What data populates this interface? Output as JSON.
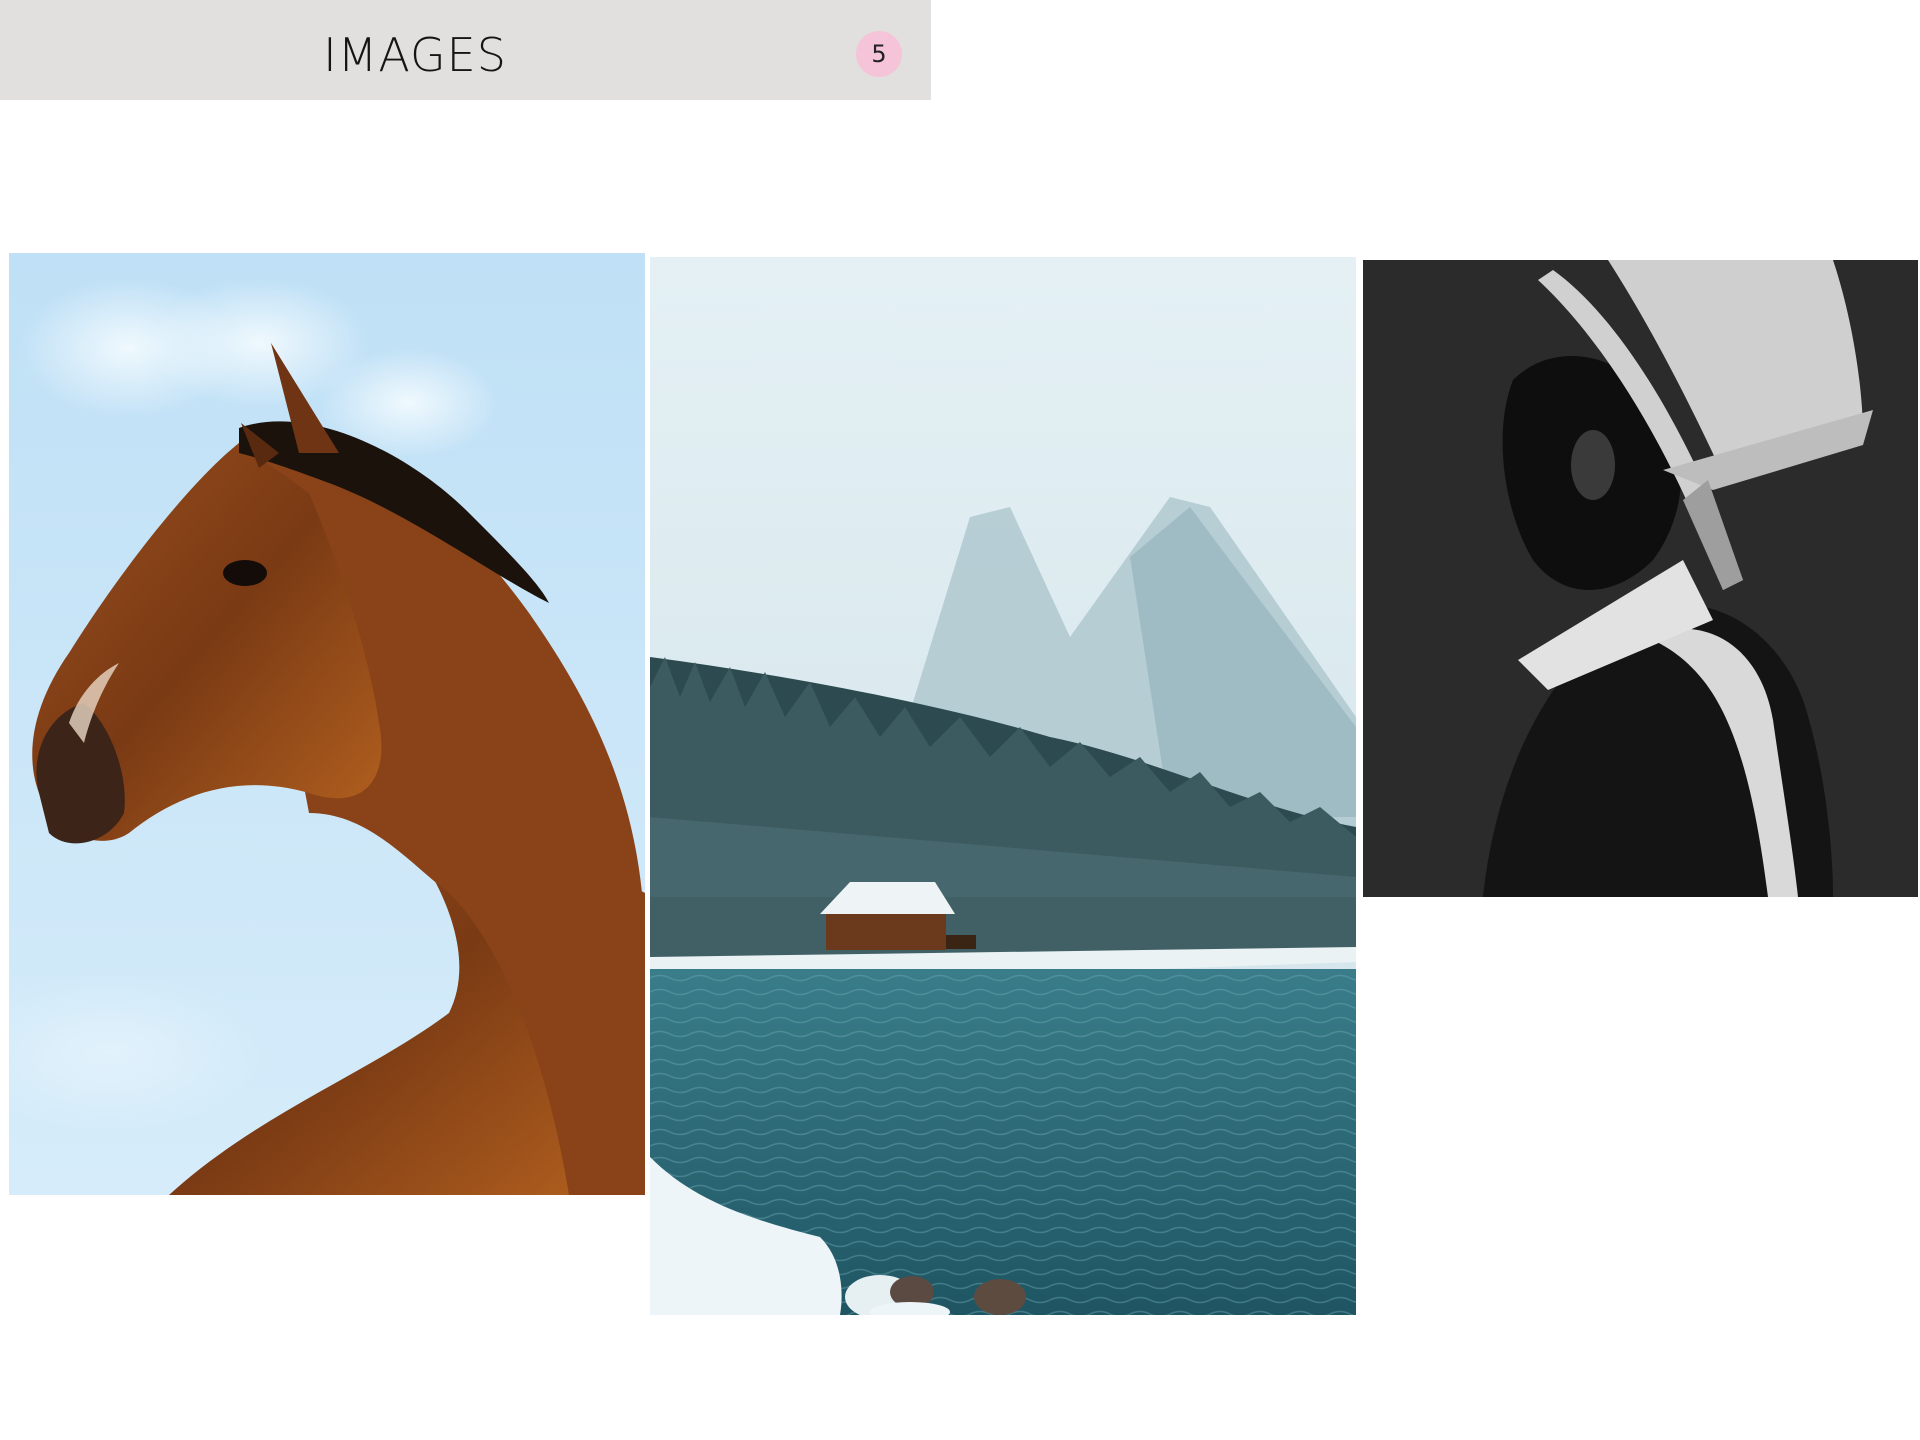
{
  "header": {
    "title": "IMAGES",
    "page_number": "5"
  },
  "colors": {
    "header_background": "#e2dfdf",
    "badge_background": "#f5c4d8"
  },
  "gallery": {
    "images": [
      {
        "subject": "horse-head-portrait-against-sky"
      },
      {
        "subject": "snowy-mountain-lake-with-cabin"
      },
      {
        "subject": "person-in-top-hat-black-and-white"
      }
    ]
  }
}
